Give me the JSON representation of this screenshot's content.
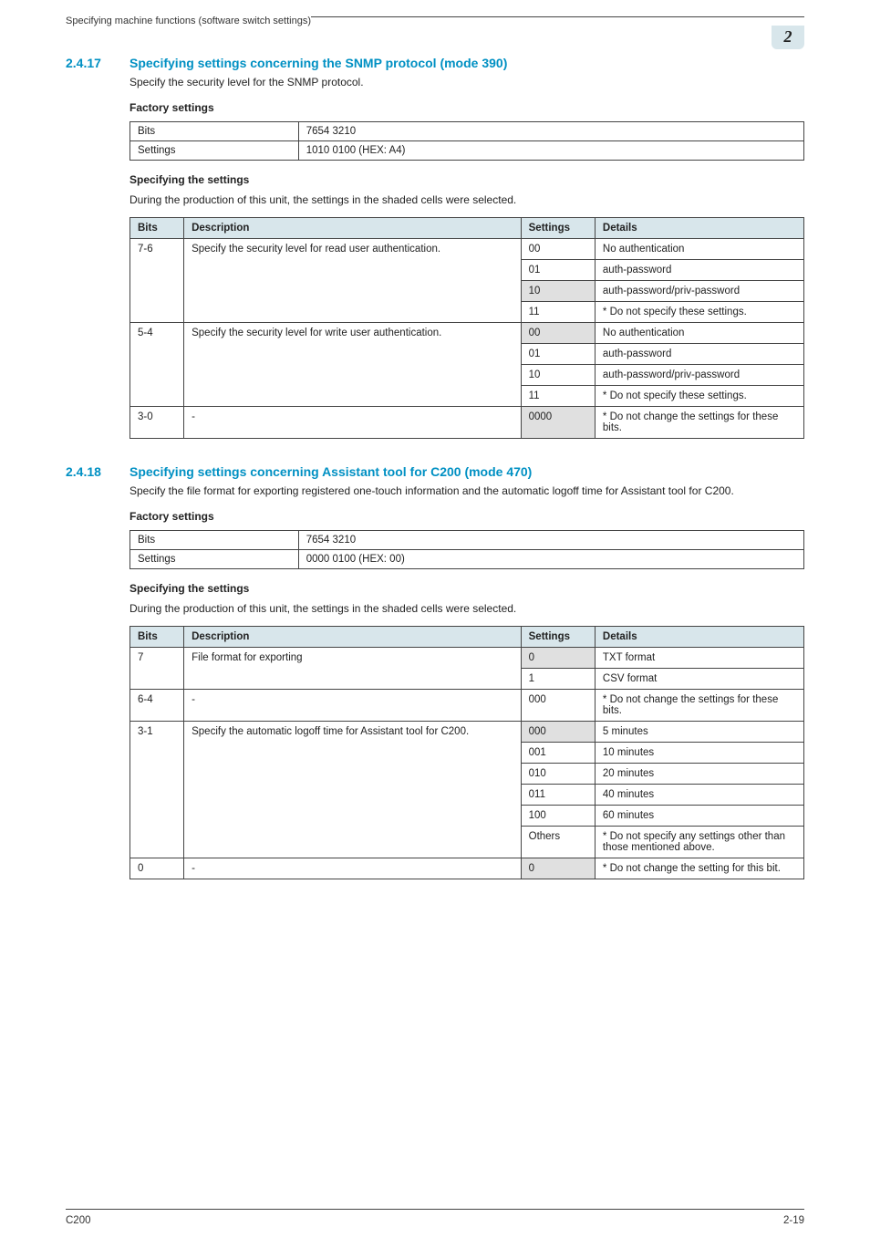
{
  "header": {
    "running_title": "Specifying machine functions (software switch settings)",
    "chapter_badge": "2"
  },
  "sections": [
    {
      "number": "2.4.17",
      "title": "Specifying settings concerning the SNMP protocol (mode 390)",
      "intro": "Specify the security level for the SNMP protocol.",
      "factory_heading": "Factory settings",
      "factory": {
        "bits_label": "Bits",
        "bits_value": "7654 3210",
        "settings_label": "Settings",
        "settings_value": "1010 0100 (HEX: A4)"
      },
      "spec_heading": "Specifying the settings",
      "spec_intro": "During the production of this unit, the settings in the shaded cells were selected.",
      "table_headers": {
        "bits": "Bits",
        "description": "Description",
        "settings": "Settings",
        "details": "Details"
      },
      "rows": [
        {
          "bits": "7-6",
          "desc": "Specify the security level for read user authentication.",
          "settings": "00",
          "details": "No authentication",
          "rowspan": 4,
          "shaded": false
        },
        {
          "settings": "01",
          "details": "auth-password",
          "shaded": false
        },
        {
          "settings": "10",
          "details": "auth-password/priv-password",
          "shaded": true
        },
        {
          "settings": "11",
          "details": "* Do not specify these settings.",
          "shaded": false
        },
        {
          "bits": "5-4",
          "desc": "Specify the security level for write user authentication.",
          "settings": "00",
          "details": "No authentication",
          "rowspan": 4,
          "shaded": true
        },
        {
          "settings": "01",
          "details": "auth-password",
          "shaded": false
        },
        {
          "settings": "10",
          "details": "auth-password/priv-password",
          "shaded": false
        },
        {
          "settings": "11",
          "details": "* Do not specify these settings.",
          "shaded": false
        },
        {
          "bits": "3-0",
          "desc": "-",
          "settings": "0000",
          "details": "* Do not change the settings for these bits.",
          "rowspan": 1,
          "shaded": true
        }
      ]
    },
    {
      "number": "2.4.18",
      "title": "Specifying settings concerning Assistant tool for C200 (mode 470)",
      "intro": "Specify the file format for exporting registered one-touch information and the automatic logoff time for Assistant tool for C200.",
      "factory_heading": "Factory settings",
      "factory": {
        "bits_label": "Bits",
        "bits_value": "7654 3210",
        "settings_label": "Settings",
        "settings_value": "0000 0100 (HEX: 00)"
      },
      "spec_heading": "Specifying the settings",
      "spec_intro": "During the production of this unit, the settings in the shaded cells were selected.",
      "table_headers": {
        "bits": "Bits",
        "description": "Description",
        "settings": "Settings",
        "details": "Details"
      },
      "rows": [
        {
          "bits": "7",
          "desc": "File format for exporting",
          "settings": "0",
          "details": "TXT format",
          "rowspan": 2,
          "shaded": true
        },
        {
          "settings": "1",
          "details": "CSV format",
          "shaded": false
        },
        {
          "bits": "6-4",
          "desc": "-",
          "settings": "000",
          "details": "* Do not change the settings for these bits.",
          "rowspan": 1,
          "shaded": false
        },
        {
          "bits": "3-1",
          "desc": "Specify the automatic logoff time for Assistant tool for C200.",
          "settings": "000",
          "details": "5 minutes",
          "rowspan": 6,
          "shaded": true
        },
        {
          "settings": "001",
          "details": "10 minutes",
          "shaded": false
        },
        {
          "settings": "010",
          "details": "20 minutes",
          "shaded": false
        },
        {
          "settings": "011",
          "details": "40 minutes",
          "shaded": false
        },
        {
          "settings": "100",
          "details": "60 minutes",
          "shaded": false
        },
        {
          "settings": "Others",
          "details": "* Do not specify any settings other than those mentioned above.",
          "shaded": false
        },
        {
          "bits": "0",
          "desc": "-",
          "settings": "0",
          "details": "* Do not change the setting for this bit.",
          "rowspan": 1,
          "shaded": true
        }
      ]
    }
  ],
  "footer": {
    "left": "C200",
    "right": "2-19"
  }
}
